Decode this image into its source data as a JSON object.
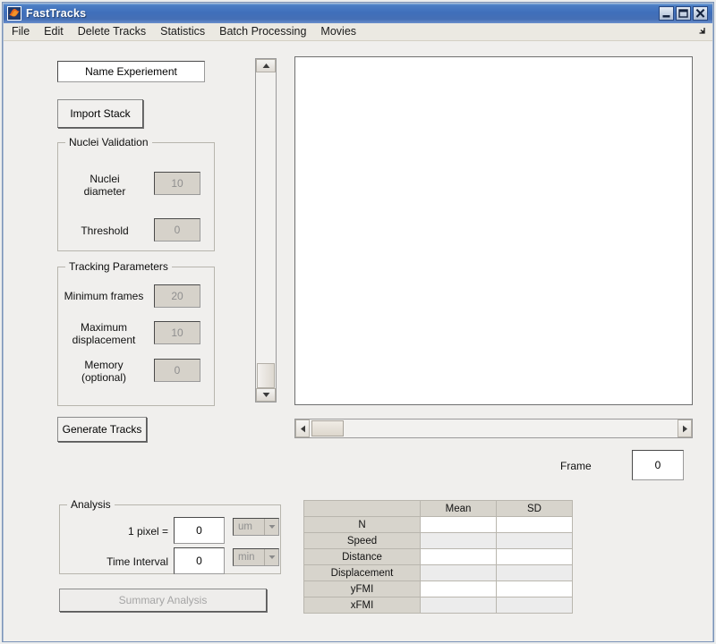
{
  "window": {
    "title": "FastTracks",
    "icon": "matlab-membrane-icon",
    "buttons": {
      "minimize": "minimize",
      "maximize": "maximize",
      "close": "close"
    }
  },
  "menubar": {
    "items": [
      {
        "label": "File"
      },
      {
        "label": "Edit"
      },
      {
        "label": "Delete Tracks"
      },
      {
        "label": "Statistics"
      },
      {
        "label": "Batch Processing"
      },
      {
        "label": "Movies"
      }
    ],
    "overflow_icon": "menu-overflow-arrow-icon"
  },
  "left_panel": {
    "experiment_name": {
      "value": "Name Experiement",
      "placeholder": "Name Experiement"
    },
    "import_stack_label": "Import Stack",
    "nuclei_validation": {
      "title": "Nuclei Validation",
      "fields": [
        {
          "label": "Nuclei\ndiameter",
          "value": "10",
          "enabled": false
        },
        {
          "label": "Threshold",
          "value": "0",
          "enabled": false
        }
      ]
    },
    "tracking_parameters": {
      "title": "Tracking Parameters",
      "fields": [
        {
          "label": "Minimum frames",
          "value": "20",
          "enabled": false
        },
        {
          "label": "Maximum\ndisplacement",
          "value": "10",
          "enabled": false
        },
        {
          "label": "Memory\n(optional)",
          "value": "0",
          "enabled": false
        }
      ]
    },
    "generate_tracks_label": "Generate Tracks"
  },
  "viewer": {
    "vertical_scrollbar": {
      "up_icon": "scroll-up-arrow-icon",
      "down_icon": "scroll-down-arrow-icon"
    },
    "horizontal_scrollbar": {
      "left_icon": "scroll-left-arrow-icon",
      "right_icon": "scroll-right-arrow-icon"
    },
    "frame": {
      "label": "Frame",
      "value": "0"
    }
  },
  "analysis": {
    "title": "Analysis",
    "pixel_label": "1 pixel  =",
    "pixel_value": "0",
    "pixel_unit": "um",
    "time_label": "Time Interval",
    "time_value": "0",
    "time_unit": "min",
    "summary_button_label": "Summary Analysis",
    "summary_button_enabled": false
  },
  "results_table": {
    "corner": "",
    "columns": [
      "Mean",
      "SD"
    ],
    "rows": [
      {
        "name": "N",
        "mean": "",
        "sd": ""
      },
      {
        "name": "Speed",
        "mean": "",
        "sd": ""
      },
      {
        "name": "Distance",
        "mean": "",
        "sd": ""
      },
      {
        "name": "Displacement",
        "mean": "",
        "sd": ""
      },
      {
        "name": "yFMI",
        "mean": "",
        "sd": ""
      },
      {
        "name": "xFMI",
        "mean": "",
        "sd": ""
      }
    ]
  },
  "colors": {
    "window_background": "#f0efed",
    "titlebar_blue": "#3f6fbb",
    "panel_border": "#b7b5ad",
    "disabled_field": "#d6d2ca",
    "table_header": "#d7d4cc",
    "accent_icon": "#e8651b"
  }
}
